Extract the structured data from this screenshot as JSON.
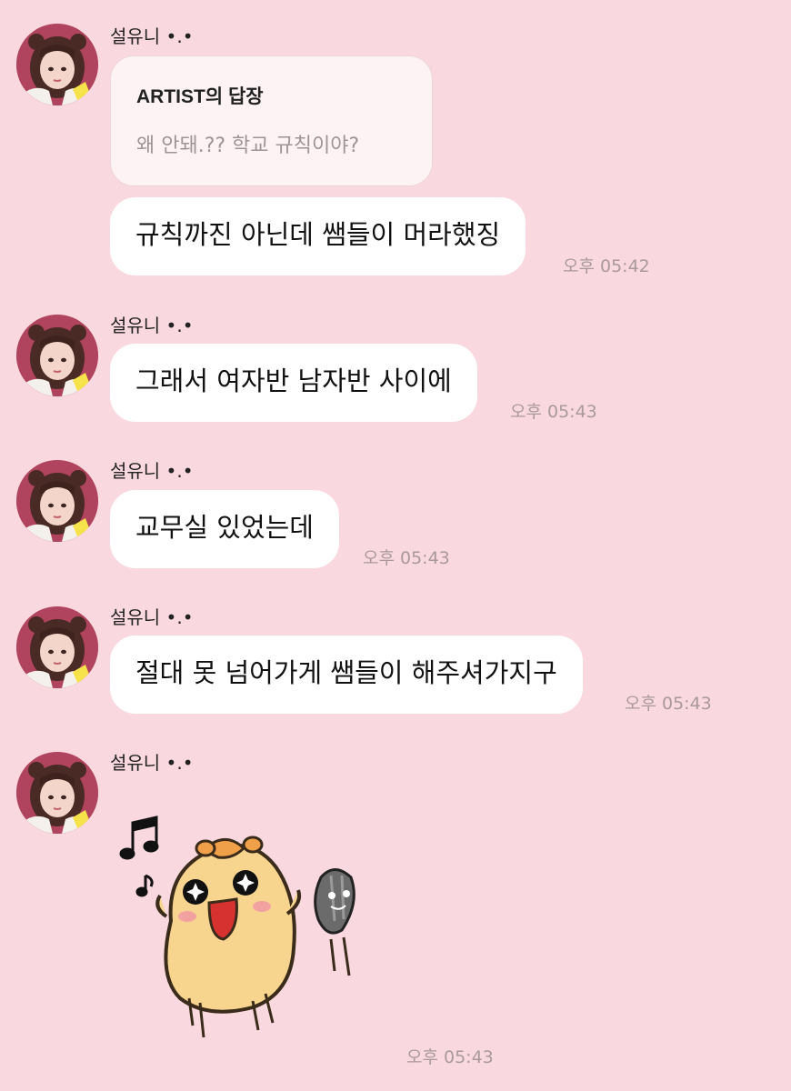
{
  "sender_name": "설유니 •.•",
  "reply": {
    "title": "ARTIST의 답장",
    "text": "왜 안돼.?? 학교 규칙이야?"
  },
  "messages": [
    {
      "text": "규칙까진 아닌데 쌤들이 머라했징",
      "time": "오후 05:42"
    },
    {
      "text": "그래서 여자반 남자반 사이에",
      "time": "오후 05:43"
    },
    {
      "text": "교무실 있었는데",
      "time": "오후 05:43"
    },
    {
      "text": "절대 못 넘어가게 쌤들이 해주셔가지구",
      "time": "오후 05:43"
    }
  ],
  "sticker": {
    "icon": "hamster-sticker-icon",
    "time": "오후 05:43"
  },
  "colors": {
    "background": "#f9d9df",
    "bubble": "#ffffff",
    "reply_card": "#fdf3f4",
    "timestamp": "#a9999d"
  }
}
